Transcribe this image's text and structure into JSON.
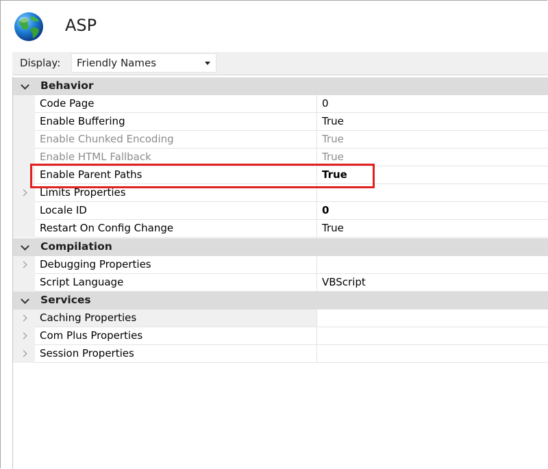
{
  "header": {
    "title": "ASP",
    "icon": "globe-icon"
  },
  "toolbar": {
    "display_label": "Display:",
    "display_value": "Friendly Names"
  },
  "categories": {
    "behavior": "Behavior",
    "compilation": "Compilation",
    "services": "Services"
  },
  "rows": {
    "code_page": {
      "name": "Code Page",
      "value": "0"
    },
    "enable_buffering": {
      "name": "Enable Buffering",
      "value": "True"
    },
    "enable_chunked_encoding": {
      "name": "Enable Chunked Encoding",
      "value": "True"
    },
    "enable_html_fallback": {
      "name": "Enable HTML Fallback",
      "value": "True"
    },
    "enable_parent_paths": {
      "name": "Enable Parent Paths",
      "value": "True"
    },
    "limits_properties": {
      "name": "Limits Properties",
      "value": ""
    },
    "locale_id": {
      "name": "Locale ID",
      "value": "0"
    },
    "restart_on_config_change": {
      "name": "Restart On Config Change",
      "value": "True"
    },
    "debugging_properties": {
      "name": "Debugging Properties",
      "value": ""
    },
    "script_language": {
      "name": "Script Language",
      "value": "VBScript"
    },
    "caching_properties": {
      "name": "Caching Properties",
      "value": ""
    },
    "com_plus_properties": {
      "name": "Com Plus Properties",
      "value": ""
    },
    "session_properties": {
      "name": "Session Properties",
      "value": ""
    }
  },
  "colors": {
    "highlight": "#e0201f",
    "category_bg": "#dcdcdc",
    "disabled_text": "#8c8c8c"
  }
}
